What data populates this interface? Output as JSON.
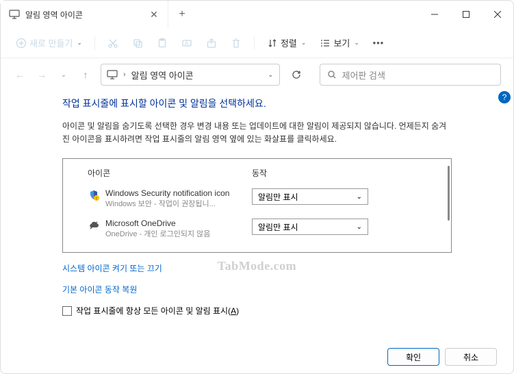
{
  "tab": {
    "title": "알림 영역 아이콘"
  },
  "toolbar": {
    "new": "새로 만들기",
    "sort": "정렬",
    "view": "보기"
  },
  "nav": {
    "breadcrumb_sep": "›",
    "location": "알림 영역 아이콘",
    "search_placeholder": "제어판 검색"
  },
  "content": {
    "heading": "작업 표시줄에 표시할 아이콘 및 알림을 선택하세요.",
    "description": "아이콘 및 알림을 숨기도록 선택한 경우 변경 내용 또는 업데이트에 대한 알림이 제공되지 않습니다. 언제든지 숨겨진 아이콘을 표시하려면 작업 표시줄의 알림 영역 옆에 있는 화살표를 클릭하세요.",
    "col_icon": "아이콘",
    "col_action": "동작",
    "rows": [
      {
        "title": "Windows Security notification icon",
        "sub": "Windows 보안 - 작업이 권장됩니...",
        "action": "알림만 표시"
      },
      {
        "title": "Microsoft OneDrive",
        "sub": "OneDrive - 개인 로그인되지 않음",
        "action": "알림만 표시"
      }
    ],
    "link_system": "시스템 아이콘 켜기 또는 끄기",
    "link_restore": "기본 아이콘 동작 복원",
    "checkbox_label": "작업 표시줄에 항상 모든 아이콘 및 알림 표시(A)"
  },
  "footer": {
    "ok": "확인",
    "cancel": "취소"
  },
  "watermark": "TabMode.com"
}
